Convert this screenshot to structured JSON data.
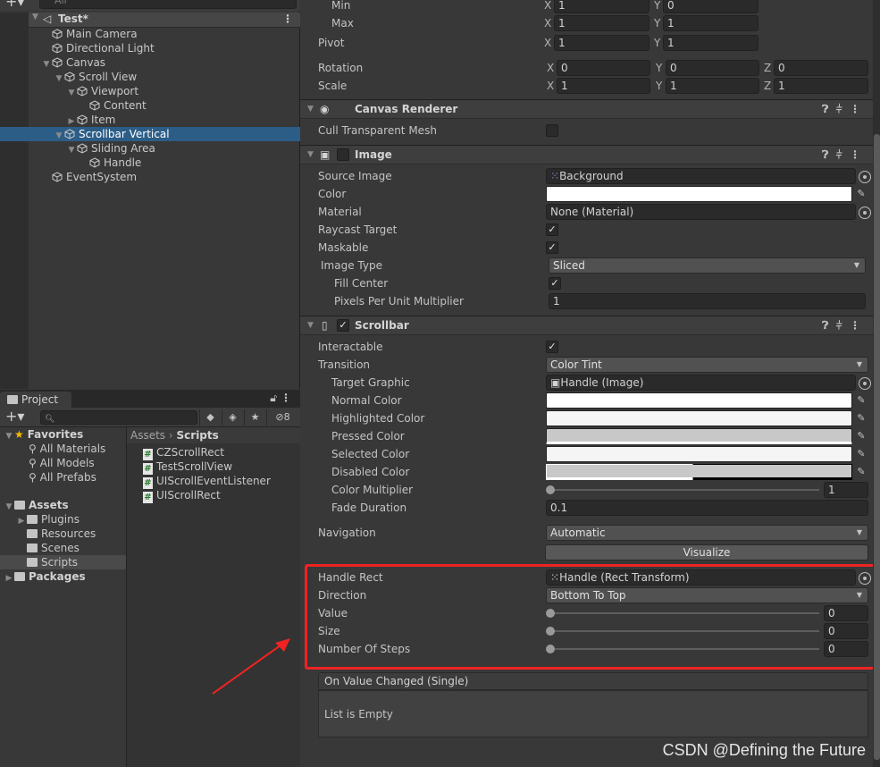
{
  "hierarchy": {
    "search_placeholder": "All",
    "scene": "Test*",
    "items": [
      {
        "label": "Main Camera",
        "depth": 0,
        "arrow": ""
      },
      {
        "label": "Directional Light",
        "depth": 0,
        "arrow": ""
      },
      {
        "label": "Canvas",
        "depth": 0,
        "arrow": "▼"
      },
      {
        "label": "Scroll View",
        "depth": 1,
        "arrow": "▼"
      },
      {
        "label": "Viewport",
        "depth": 2,
        "arrow": "▼"
      },
      {
        "label": "Content",
        "depth": 3,
        "arrow": ""
      },
      {
        "label": "Item",
        "depth": 2,
        "arrow": "▶"
      },
      {
        "label": "Scrollbar Vertical",
        "depth": 1,
        "arrow": "▼",
        "selected": true
      },
      {
        "label": "Sliding Area",
        "depth": 2,
        "arrow": "▼"
      },
      {
        "label": "Handle",
        "depth": 3,
        "arrow": ""
      },
      {
        "label": "EventSystem",
        "depth": 0,
        "arrow": ""
      }
    ]
  },
  "project": {
    "tab": "Project",
    "hidden_count": "8",
    "tree": {
      "favorites": "Favorites",
      "favorite_items": [
        "All Materials",
        "All Models",
        "All Prefabs"
      ],
      "assets": "Assets",
      "asset_folders": [
        "Plugins",
        "Resources",
        "Scenes",
        "Scripts"
      ],
      "packages": "Packages"
    },
    "breadcrumb": {
      "root": "Assets",
      "current": "Scripts"
    },
    "files": [
      "CZScrollRect",
      "TestScrollView",
      "UIScrollEventListener",
      "UIScrollRect"
    ]
  },
  "inspector": {
    "anchors": {
      "min_label": "Min",
      "min_x": "1",
      "min_y": "0",
      "max_label": "Max",
      "max_x": "1",
      "max_y": "1",
      "pivot_label": "Pivot",
      "pivot_x": "1",
      "pivot_y": "1",
      "rotation_label": "Rotation",
      "rot_x": "0",
      "rot_y": "0",
      "rot_z": "0",
      "scale_label": "Scale",
      "scale_x": "1",
      "scale_y": "1",
      "scale_z": "1"
    },
    "canvas_renderer": {
      "title": "Canvas Renderer",
      "cull_label": "Cull Transparent Mesh",
      "cull": false
    },
    "image": {
      "title": "Image",
      "source_image_label": "Source Image",
      "source_image": "Background",
      "color_label": "Color",
      "color": "#ffffff",
      "material_label": "Material",
      "material": "None (Material)",
      "raycast_label": "Raycast Target",
      "raycast": true,
      "maskable_label": "Maskable",
      "maskable": true,
      "image_type_label": "Image Type",
      "image_type": "Sliced",
      "fill_center_label": "Fill Center",
      "fill_center": true,
      "ppu_label": "Pixels Per Unit Multiplier",
      "ppu": "1"
    },
    "scrollbar": {
      "title": "Scrollbar",
      "interactable_label": "Interactable",
      "interactable": true,
      "transition_label": "Transition",
      "transition": "Color Tint",
      "target_graphic_label": "Target Graphic",
      "target_graphic": "Handle (Image)",
      "normal_color_label": "Normal Color",
      "normal_color": "#ffffff",
      "highlighted_color_label": "Highlighted Color",
      "highlighted_color": "#f5f5f5",
      "pressed_color_label": "Pressed Color",
      "pressed_color": "#c8c8c8",
      "selected_color_label": "Selected Color",
      "selected_color": "#f5f5f5",
      "disabled_color_label": "Disabled Color",
      "disabled_color": "#c8c8c8",
      "color_multiplier_label": "Color Multiplier",
      "color_multiplier": "1",
      "fade_duration_label": "Fade Duration",
      "fade_duration": "0.1",
      "navigation_label": "Navigation",
      "navigation": "Automatic",
      "visualize_label": "Visualize",
      "handle_rect_label": "Handle Rect",
      "handle_rect": "Handle (Rect Transform)",
      "direction_label": "Direction",
      "direction": "Bottom To Top",
      "value_label": "Value",
      "value": "0",
      "size_label": "Size",
      "size": "0",
      "steps_label": "Number Of Steps",
      "steps": "0",
      "event_label": "On Value Changed (Single)",
      "event_empty": "List is Empty"
    }
  },
  "watermark": "CSDN @Defining the Future",
  "colors": {
    "selection": "#2c5d87",
    "highlight_box": "#ef2323"
  }
}
